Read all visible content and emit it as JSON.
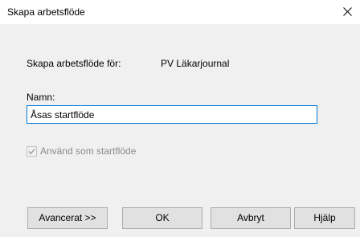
{
  "window": {
    "title": "Skapa arbetsflöde",
    "close_glyph": "×"
  },
  "form": {
    "for_label": "Skapa arbetsflöde för:",
    "for_value": "PV Läkarjournal",
    "name_label": "Namn:",
    "name_value": "Åsas startflöde",
    "use_as_start_label": "Använd som startflöde",
    "use_as_start_checked": true,
    "use_as_start_enabled": false
  },
  "buttons": {
    "advanced": "Avancerat >>",
    "ok": "OK",
    "cancel": "Avbryt",
    "help": "Hjälp"
  },
  "colors": {
    "dialog_bg": "#f0f0f0",
    "titlebar_bg": "#ffffff",
    "focus_border": "#0078d7",
    "disabled_text": "#8a8a8a"
  }
}
